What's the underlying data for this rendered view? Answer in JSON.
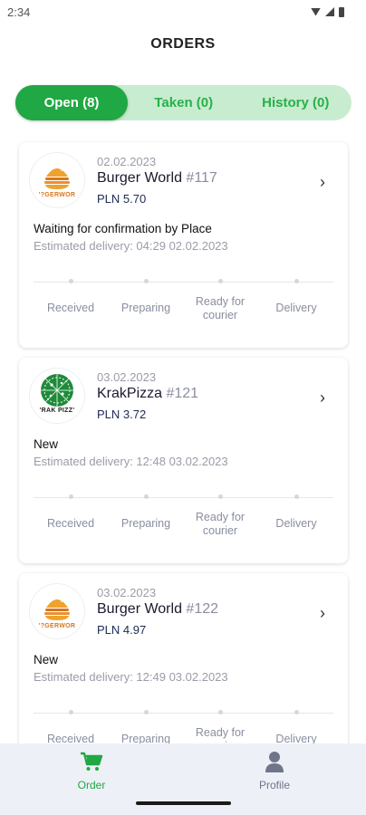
{
  "status_bar": {
    "time": "2:34"
  },
  "header": {
    "title": "ORDERS"
  },
  "tabs": [
    {
      "label": "Open (8)",
      "active": true
    },
    {
      "label": "Taken (0)",
      "active": false
    },
    {
      "label": "History (0)",
      "active": false
    }
  ],
  "orders": [
    {
      "date": "02.02.2023",
      "place": "Burger World",
      "order_no": "#117",
      "price": "PLN 5.70",
      "status": "Waiting for confirmation by Place",
      "eta": "Estimated delivery: 04:29 02.02.2023",
      "logo_text": "'?GERWOR",
      "logo_icon": "burger-icon"
    },
    {
      "date": "03.02.2023",
      "place": "KrakPizza",
      "order_no": "#121",
      "price": "PLN 3.72",
      "status": "New",
      "eta": "Estimated delivery: 12:48 03.02.2023",
      "logo_text": "'RAK PIZZ'",
      "logo_icon": "pizza-icon"
    },
    {
      "date": "03.02.2023",
      "place": "Burger World",
      "order_no": "#122",
      "price": "PLN 4.97",
      "status": "New",
      "eta": "Estimated delivery: 12:49 03.02.2023",
      "logo_text": "'?GERWOR",
      "logo_icon": "burger-icon"
    }
  ],
  "steps": [
    "Received",
    "Preparing",
    "Ready for courier",
    "Delivery"
  ],
  "bottom_nav": [
    {
      "label": "Order",
      "icon": "cart-icon",
      "active": true
    },
    {
      "label": "Profile",
      "icon": "person-icon",
      "active": false
    }
  ],
  "colors": {
    "accent": "#1fa843",
    "accent_light": "#c8ecd0",
    "muted": "#9a9ca8"
  }
}
